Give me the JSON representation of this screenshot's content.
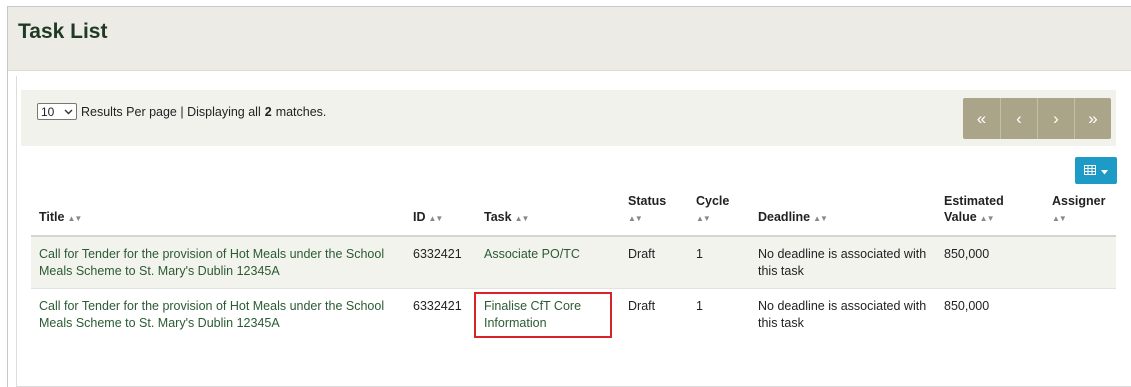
{
  "panel": {
    "title": "Task List"
  },
  "pager": {
    "per_page_value": "10",
    "per_page_suffix": "Results Per page | Displaying all",
    "match_count": "2",
    "matches_suffix": "matches.",
    "first": "«",
    "prev": "‹",
    "next": "›",
    "last": "»"
  },
  "columns": {
    "title": "Title",
    "id": "ID",
    "task": "Task",
    "status": "Status",
    "cycle": "Cycle",
    "deadline": "Deadline",
    "estimated_value_1": "Estimated",
    "estimated_value_2": "Value",
    "assigner": "Assigner"
  },
  "rows": [
    {
      "title": "Call for Tender for the provision of Hot Meals under the School Meals Scheme to St. Mary's Dublin 12345A",
      "id": "6332421",
      "task": "Associate PO/TC",
      "status": "Draft",
      "cycle": "1",
      "deadline": "No deadline is associated with this task",
      "estimated_value": "850,000",
      "assigner": ""
    },
    {
      "title": "Call for Tender for the provision of Hot Meals under the School Meals Scheme to St. Mary's Dublin 12345A",
      "id": "6332421",
      "task": "Finalise CfT Core Information",
      "status": "Draft",
      "cycle": "1",
      "deadline": "No deadline is associated with this task",
      "estimated_value": "850,000",
      "assigner": ""
    }
  ],
  "icons": {
    "sort": "sort-arrows-icon",
    "column_toggle": "grid-icon",
    "dropdown": "chevron-down-icon"
  },
  "colors": {
    "header_bg": "#ecebe6",
    "title_text": "#1e3a24",
    "link": "#2a5b32",
    "pager_bg": "#aaa488",
    "column_toggle_bg": "#1d9ac6",
    "highlight": "#d8232a"
  }
}
